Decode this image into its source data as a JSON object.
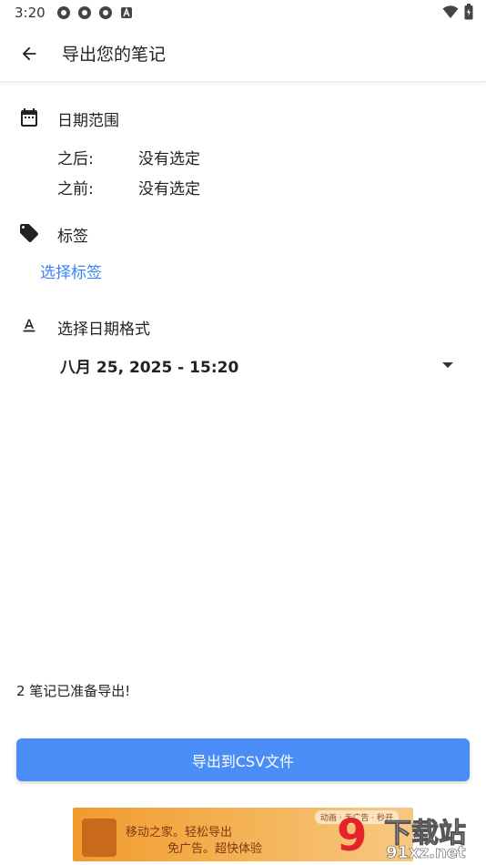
{
  "status_bar": {
    "time": "3:20",
    "notification_icons": [
      "android-ring-icon",
      "android-ring-icon",
      "android-ring-icon",
      "a-box-icon"
    ]
  },
  "app_bar": {
    "title": "导出您的笔记"
  },
  "date_range": {
    "title": "日期范围",
    "after_label": "之后:",
    "after_value": "没有选定",
    "before_label": "之前:",
    "before_value": "没有选定"
  },
  "tags": {
    "title": "标签",
    "select_link": "选择标签"
  },
  "date_format": {
    "title": "选择日期格式",
    "selected_value": "八月 25, 2025 - 15:20"
  },
  "footer": {
    "ready_text": "2 笔记已准备导出!",
    "export_button": "导出到CSV文件"
  },
  "ad": {
    "line1": "移动之家。轻松导出",
    "line2": "免广告。超快体验",
    "tabs": "动画 · 无广告 · 秒开"
  },
  "watermark": {
    "number": "9",
    "chinese": "下载站",
    "url": "91xz.net"
  },
  "colors": {
    "accent": "#3b82f6",
    "button": "#4a8df6",
    "watermark_red": "#e3242b"
  }
}
